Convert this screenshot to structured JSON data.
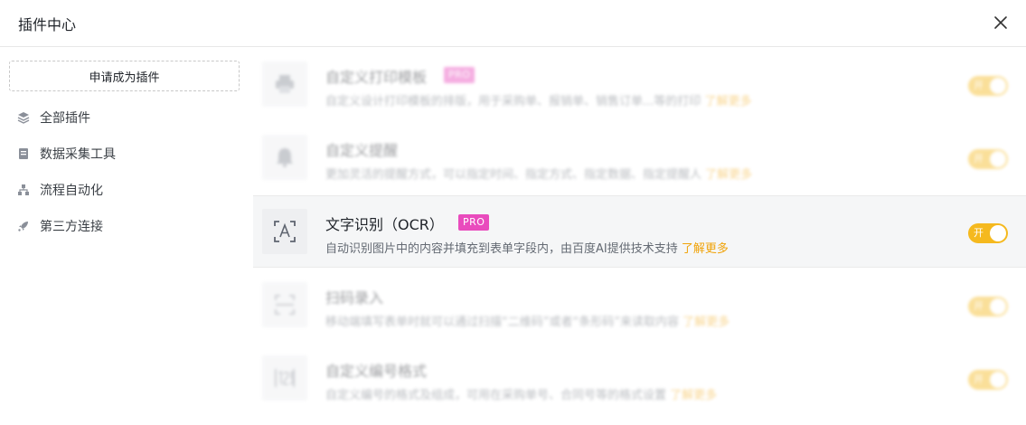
{
  "header": {
    "title": "插件中心"
  },
  "sidebar": {
    "apply_button": "申请成为插件",
    "items": [
      {
        "label": "全部插件",
        "icon": "layers-icon"
      },
      {
        "label": "数据采集工具",
        "icon": "form-icon"
      },
      {
        "label": "流程自动化",
        "icon": "flow-icon"
      },
      {
        "label": "第三方连接",
        "icon": "rocket-icon"
      }
    ]
  },
  "plugins": [
    {
      "name": "自定义打印模板",
      "pro": "PRO",
      "desc": "自定义设计打印模板的排版，用于采购单、报销单、销售订单...等的打印",
      "more": "了解更多",
      "toggle": "开",
      "icon": "printer-icon",
      "enabled": true
    },
    {
      "name": "自定义提醒",
      "desc": "更加灵活的提醒方式，可以指定时间、指定方式、指定数据、指定提醒人",
      "more": "了解更多",
      "toggle": "开",
      "icon": "bell-icon",
      "enabled": true
    },
    {
      "name": "文字识别（OCR）",
      "pro": "PRO",
      "desc": "自动识别图片中的内容并填充到表单字段内，由百度AI提供技术支持",
      "more": "了解更多",
      "toggle": "开",
      "icon": "ocr-icon",
      "enabled": true
    },
    {
      "name": "扫码录入",
      "desc": "移动端填写表单时就可以通过扫描“二维码”或者“条形码”来读取内容",
      "more": "了解更多",
      "toggle": "开",
      "icon": "scan-icon",
      "enabled": true
    },
    {
      "name": "自定义编号格式",
      "desc": "自定义编号的格式及组成，可用在采购单号、合同号等的格式设置",
      "more": "了解更多",
      "toggle": "开",
      "icon": "number-format-icon",
      "enabled": true
    }
  ],
  "colors": {
    "accent": "#f5b91e",
    "pro_badge": "#e94bbd",
    "link": "#f0a30a"
  }
}
